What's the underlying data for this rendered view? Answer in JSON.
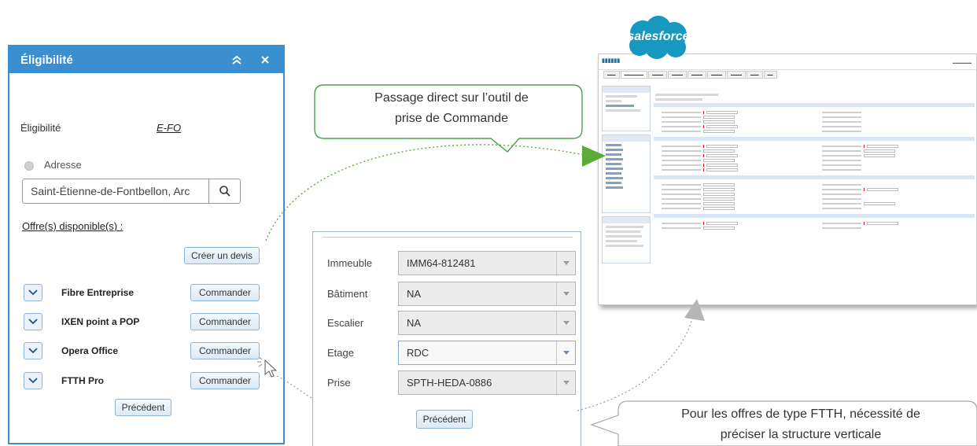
{
  "eligibility_panel": {
    "title": "Éligibilité",
    "eligibility_label": "Éligibilité",
    "eligibility_value": "E-FO",
    "address_label": "Adresse",
    "address_value": "Saint-Étienne-de-Fontbellon, Arc",
    "offers_title": "Offre(s) disponible(s) :",
    "create_quote_label": "Créer un devis",
    "offers": [
      {
        "name": "Fibre Entreprise",
        "action": "Commander"
      },
      {
        "name": "IXEN point a POP",
        "action": "Commander"
      },
      {
        "name": "Opera Office",
        "action": "Commander"
      },
      {
        "name": "FTTH Pro",
        "action": "Commander"
      }
    ],
    "previous_label": "Précédent"
  },
  "building_form": {
    "fields": [
      {
        "label": "Immeuble",
        "value": "IMM64-812481"
      },
      {
        "label": "Bâtiment",
        "value": "NA"
      },
      {
        "label": "Escalier",
        "value": "NA"
      },
      {
        "label": "Etage",
        "value": "RDC"
      },
      {
        "label": "Prise",
        "value": "SPTH-HEDA-0886"
      }
    ],
    "previous_label": "Précédent"
  },
  "salesforce": {
    "logo_text": "salesforce"
  },
  "callouts": {
    "top_line1": "Passage direct sur l’outil de",
    "top_line2": "prise de Commande",
    "bottom_line1": "Pour les offres de type FTTH, nécessité de",
    "bottom_line2": "préciser la structure verticale"
  },
  "colors": {
    "header_blue": "#3a8fd0",
    "callout_green": "#4aa04a",
    "arrow_green": "#5cab3a",
    "arrow_gray": "#b5b5b5",
    "salesforce_blue": "#1798c1"
  }
}
